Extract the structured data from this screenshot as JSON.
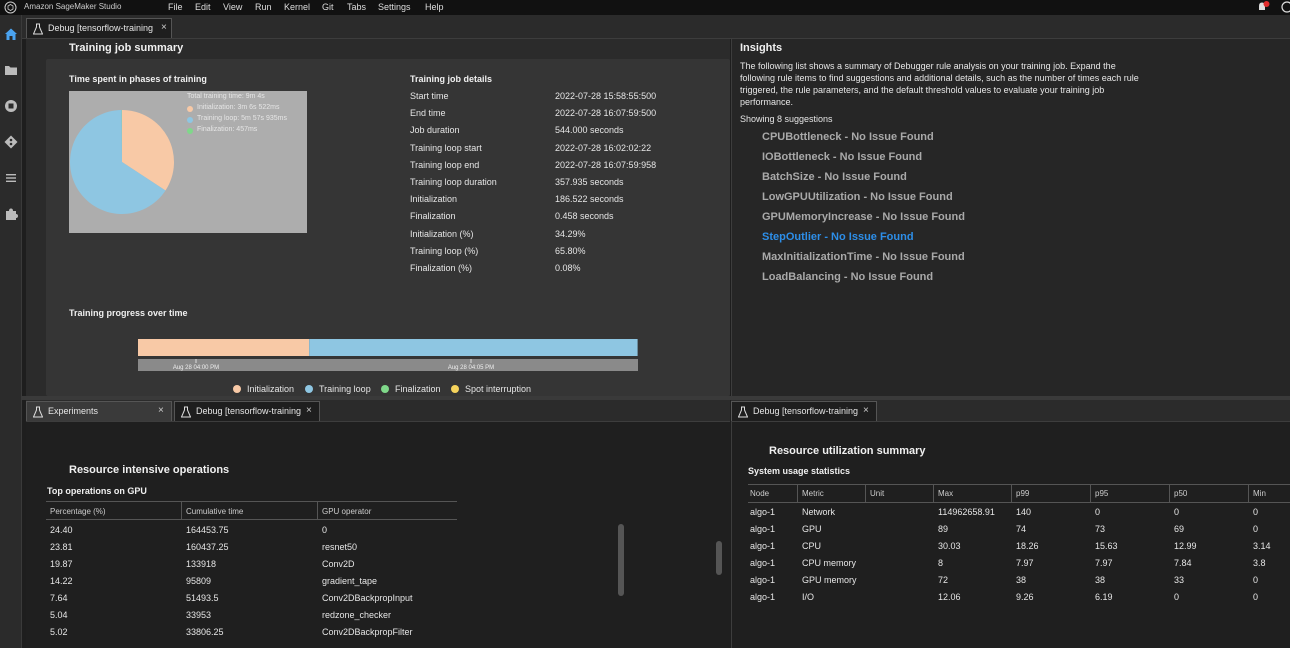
{
  "menubar": {
    "app_name": "Amazon SageMaker Studio",
    "items": [
      "File",
      "Edit",
      "View",
      "Run",
      "Kernel",
      "Git",
      "Tabs",
      "Settings",
      "Help"
    ]
  },
  "sidebar": {
    "icons": [
      "home-icon",
      "folder-icon",
      "stop-circle-icon",
      "git-icon",
      "list-icon",
      "extension-icon"
    ]
  },
  "top_tab": {
    "label": "Debug [tensorflow-training",
    "close": "×"
  },
  "summary": {
    "title": "Training job summary",
    "pie_title": "Time spent in phases of training",
    "pie_legend": [
      "Total training time: 9m 4s",
      "Initialization: 3m 6s 522ms",
      "Training loop: 5m 57s 935ms",
      "Finalization: 457ms"
    ],
    "details_title": "Training job details",
    "details": [
      {
        "label": "Start time",
        "value": "2022-07-28 15:58:55:500"
      },
      {
        "label": "End time",
        "value": "2022-07-28 16:07:59:500"
      },
      {
        "label": "Job duration",
        "value": "544.000 seconds"
      },
      {
        "label": "Training loop start",
        "value": "2022-07-28 16:02:02:22"
      },
      {
        "label": "Training loop end",
        "value": "2022-07-28 16:07:59:958"
      },
      {
        "label": "Training loop duration",
        "value": "357.935 seconds"
      },
      {
        "label": "Initialization",
        "value": "186.522 seconds"
      },
      {
        "label": "Finalization",
        "value": "0.458 seconds"
      },
      {
        "label": "Initialization (%)",
        "value": "34.29%"
      },
      {
        "label": "Training loop (%)",
        "value": "65.80%"
      },
      {
        "label": "Finalization (%)",
        "value": "0.08%"
      }
    ],
    "progress_title": "Training progress over time",
    "progress_ticks": [
      "Aug 28 04:00 PM",
      "Aug 28 04:05 PM"
    ],
    "progress_legend": [
      "Initialization",
      "Training loop",
      "Finalization",
      "Spot interruption"
    ]
  },
  "chart_data": [
    {
      "type": "pie",
      "title": "Time spent in phases of training",
      "categories": [
        "Initialization",
        "Training loop",
        "Finalization"
      ],
      "values": [
        34.29,
        65.8,
        0.08
      ],
      "colors": [
        "#f8c9a6",
        "#8ec6e2",
        "#7fd88a"
      ]
    },
    {
      "type": "bar",
      "title": "Training progress over time",
      "categories": [
        "Initialization",
        "Training loop"
      ],
      "values": [
        34.29,
        65.8
      ],
      "colors": [
        "#f8c9a6",
        "#8ec6e2"
      ]
    }
  ],
  "colors": {
    "initialization": "#f8c9a6",
    "training_loop": "#8ec6e2",
    "finalization": "#7fd88a",
    "spot_interruption": "#f5d35c",
    "active_rule": "#2d8ee8"
  },
  "insights": {
    "title": "Insights",
    "description": "The following list shows a summary of Debugger rule analysis on your training job. Expand the following rule items to find suggestions and additional details, such as the number of times each rule triggered, the rule parameters, and the default threshold values to evaluate your training job performance.",
    "showing": "Showing 8 suggestions",
    "rules": [
      "CPUBottleneck - No Issue Found",
      "IOBottleneck - No Issue Found",
      "BatchSize - No Issue Found",
      "LowGPUUtilization - No Issue Found",
      "GPUMemoryIncrease - No Issue Found",
      "StepOutlier - No Issue Found",
      "MaxInitializationTime - No Issue Found",
      "LoadBalancing - No Issue Found"
    ]
  },
  "bottom_left_tabs": [
    {
      "label": "Experiments",
      "close": "×"
    },
    {
      "label": "Debug [tensorflow-training",
      "close": "×"
    }
  ],
  "bottom_right_tab": {
    "label": "Debug [tensorflow-training",
    "close": "×"
  },
  "ops": {
    "title": "Resource intensive operations",
    "subtitle": "Top operations on GPU",
    "headers": [
      "Percentage (%)",
      "Cumulative time",
      "GPU operator"
    ],
    "rows": [
      [
        "24.40",
        "164453.75",
        "0"
      ],
      [
        "23.81",
        "160437.25",
        "resnet50"
      ],
      [
        "19.87",
        "133918",
        "Conv2D"
      ],
      [
        "14.22",
        "95809",
        "gradient_tape"
      ],
      [
        "7.64",
        "51493.5",
        "Conv2DBackpropInput"
      ],
      [
        "5.04",
        "33953",
        "redzone_checker"
      ],
      [
        "5.02",
        "33806.25",
        "Conv2DBackpropFilter"
      ]
    ]
  },
  "util": {
    "title": "Resource utilization summary",
    "subtitle": "System usage statistics",
    "headers": [
      "Node",
      "Metric",
      "Unit",
      "Max",
      "p99",
      "p95",
      "p50",
      "Min"
    ],
    "rows": [
      [
        "algo-1",
        "Network",
        "",
        "114962658.91",
        "140",
        "0",
        "0",
        "0"
      ],
      [
        "algo-1",
        "GPU",
        "",
        "89",
        "74",
        "73",
        "69",
        "0"
      ],
      [
        "algo-1",
        "CPU",
        "",
        "30.03",
        "18.26",
        "15.63",
        "12.99",
        "3.14"
      ],
      [
        "algo-1",
        "CPU memory",
        "",
        "8",
        "7.97",
        "7.97",
        "7.84",
        "3.8"
      ],
      [
        "algo-1",
        "GPU memory",
        "",
        "72",
        "38",
        "38",
        "33",
        "0"
      ],
      [
        "algo-1",
        "I/O",
        "",
        "12.06",
        "9.26",
        "6.19",
        "0",
        "0"
      ]
    ]
  }
}
